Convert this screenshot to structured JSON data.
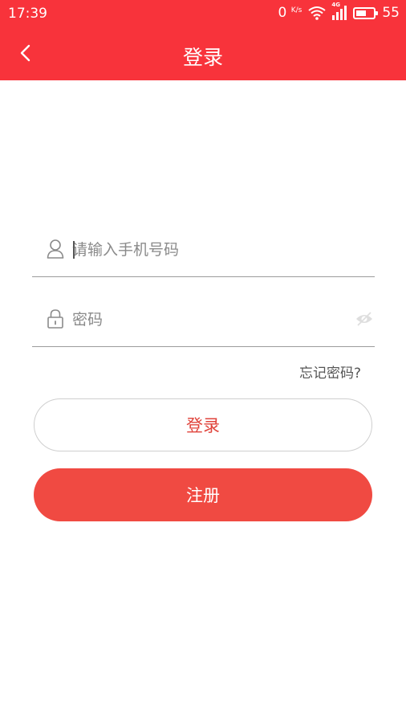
{
  "status_bar": {
    "time": "17:39",
    "net_speed": "0",
    "net_speed_unit": "K/s",
    "network_type": "4G",
    "battery_level": "55"
  },
  "nav": {
    "title": "登录"
  },
  "form": {
    "phone_placeholder": "请输入手机号码",
    "password_placeholder": "密码",
    "forgot_label": "忘记密码?"
  },
  "buttons": {
    "login_label": "登录",
    "register_label": "注册"
  },
  "colors": {
    "header_bg": "#f8333b",
    "register_bg": "#f04a42",
    "login_text": "#e0443c"
  },
  "icons": [
    "back-arrow-icon",
    "wifi-icon",
    "signal-icon",
    "battery-icon",
    "user-icon",
    "lock-icon",
    "eye-icon"
  ]
}
